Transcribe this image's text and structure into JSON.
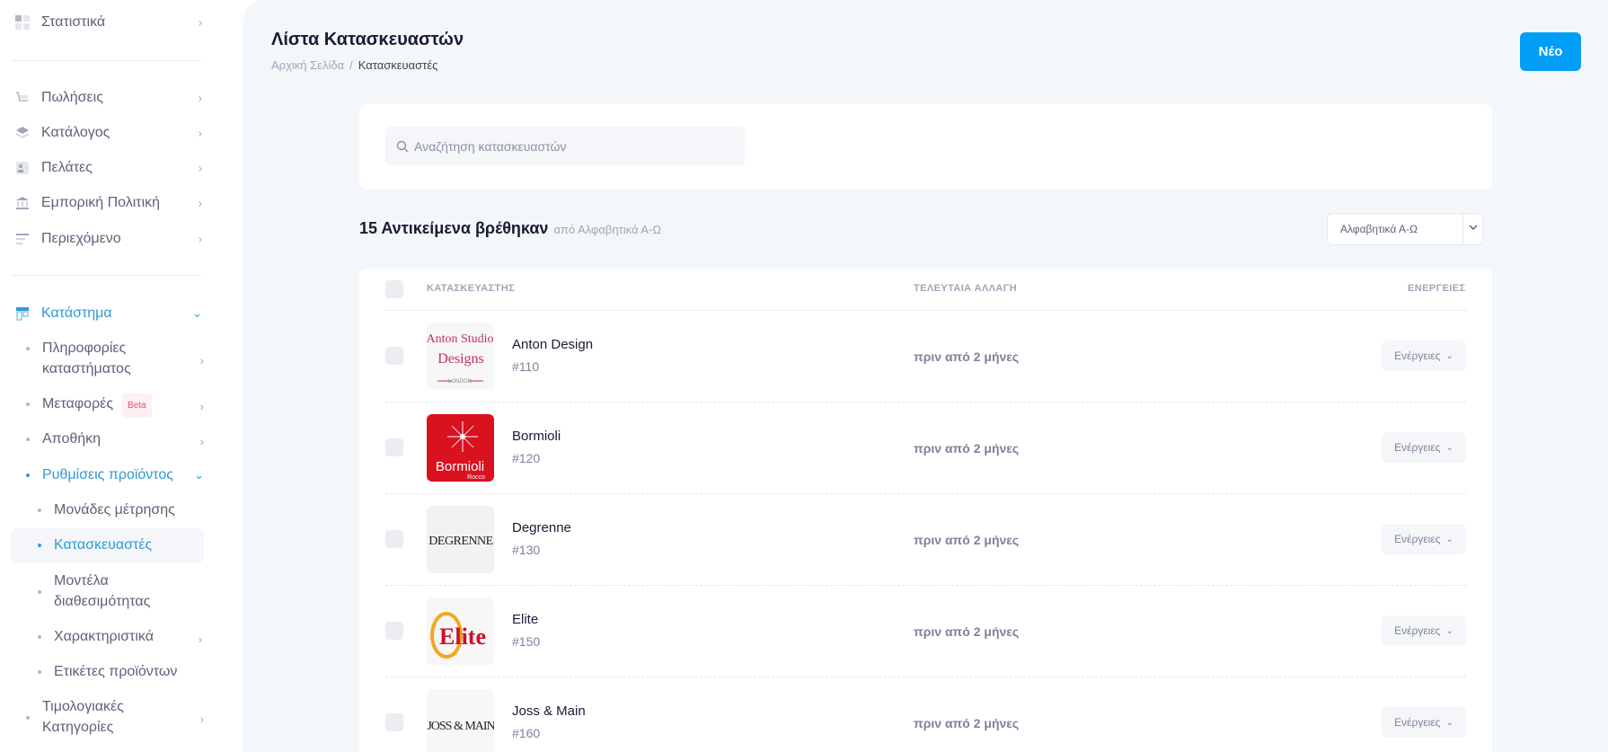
{
  "sidebar": {
    "items": [
      {
        "label": "Στατιστικά",
        "icon": "stats-icon"
      },
      {
        "label": "Πωλήσεις",
        "icon": "cart-icon"
      },
      {
        "label": "Κατάλογος",
        "icon": "layers-icon"
      },
      {
        "label": "Πελάτες",
        "icon": "users-icon"
      },
      {
        "label": "Εμπορική Πολιτική",
        "icon": "bank-icon"
      },
      {
        "label": "Περιεχόμενο",
        "icon": "content-icon"
      },
      {
        "label": "Κατάστημα",
        "icon": "store-icon"
      }
    ],
    "store_children": [
      {
        "label": "Πληροφορίες καταστήματος"
      },
      {
        "label": "Μεταφορές",
        "badge": "Beta"
      },
      {
        "label": "Αποθήκη"
      },
      {
        "label": "Ρυθμίσεις προϊόντος"
      }
    ],
    "product_settings_children": [
      {
        "label": "Μονάδες μέτρησης"
      },
      {
        "label": "Κατασκευαστές"
      },
      {
        "label": "Μοντέλα διαθεσιμότητας"
      },
      {
        "label": "Χαρακτηριστικά"
      },
      {
        "label": "Ετικέτες προϊόντων"
      }
    ],
    "pricing_categories": {
      "label": "Τιμολογιακές Κατηγορίες"
    }
  },
  "header": {
    "title": "Λίστα Κατασκευαστών",
    "breadcrumb": [
      "Αρχική Σελίδα",
      "/",
      "Κατασκευαστές"
    ],
    "new_button": "Νέο"
  },
  "search": {
    "placeholder": "Αναζήτηση κατασκευαστών"
  },
  "results": {
    "count_text": "15 Αντικείμενα βρέθηκαν",
    "sort_text": "από Αλφαβητικά Α-Ω",
    "sort_selected": "Αλφαβητικά Α-Ω"
  },
  "table": {
    "columns": [
      "ΚΑΤΑΣΚΕΥΑΣΤΗΣ",
      "ΤΕΛΕΥΤΑΙΑ ΑΛΛΑΓΗ",
      "ΕΝΕΡΓΕΙΕΣ"
    ],
    "rows": [
      {
        "name": "Anton Design",
        "id": "#110",
        "modified": "πριν από 2 μήνες",
        "action": "Ενέργειες",
        "logo_text": [
          "Anton Studio",
          "Designs",
          "LONDON"
        ]
      },
      {
        "name": "Bormioli",
        "id": "#120",
        "modified": "πριν από 2 μήνες",
        "action": "Ενέργειες",
        "logo_text": [
          "Bormioli",
          "Rocco"
        ]
      },
      {
        "name": "Degrenne",
        "id": "#130",
        "modified": "πριν από 2 μήνες",
        "action": "Ενέργειες",
        "logo_text": [
          "DEGRENNE"
        ]
      },
      {
        "name": "Elite",
        "id": "#150",
        "modified": "πριν από 2 μήνες",
        "action": "Ενέργειες",
        "logo_text": [
          "Elite"
        ]
      },
      {
        "name": "Joss & Main",
        "id": "#160",
        "modified": "πριν από 2 μήνες",
        "action": "Ενέργειες",
        "logo_text": [
          "JOSS & MAIN"
        ]
      }
    ]
  },
  "colors": {
    "accent": "#009ef7",
    "active_nav": "#2e9bd6",
    "bormioli_red": "#d9121f"
  }
}
